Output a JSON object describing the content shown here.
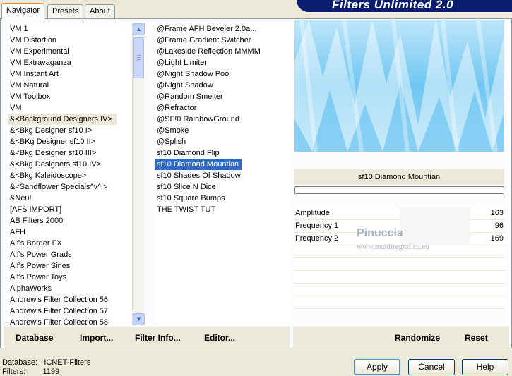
{
  "tabs": [
    {
      "label": "Navigator"
    },
    {
      "label": "Presets"
    },
    {
      "label": "About"
    }
  ],
  "banner": {
    "title": "Filters Unlimited 2.0"
  },
  "categories": [
    "VM 1",
    "VM Distortion",
    "VM Experimental",
    "VM Extravaganza",
    "VM Instant Art",
    "VM Natural",
    "VM Toolbox",
    "VM",
    "&<Background Designers IV>",
    "&<Bkg Designer sf10 I>",
    "&<BKg Designer sf10 II>",
    "&<Bkg Designer sf10 III>",
    "&<Bkg Designers sf10 IV>",
    "&<Bkg Kaleidoscope>",
    "&<Sandflower Specials^v^ >",
    "&Neu!",
    "[AFS IMPORT]",
    "AB Filters 2000",
    "AFH",
    "Alf's Border FX",
    "Alf's Power Grads",
    "Alf's Power Sines",
    "Alf's Power Toys",
    "AlphaWorks",
    "Andrew's Filter Collection 56",
    "Andrew's Filter Collection 57",
    "Andrew's Filter Collection 58"
  ],
  "filters": [
    "@Frame AFH Beveler 2.0a...",
    "@Frame Gradient Switcher",
    "@Lakeside Reflection MMMM",
    "@Light Limiter",
    "@Night Shadow Pool",
    "@Night Shadow",
    "@Random Smelter",
    "@Refractor",
    "@SF!0 RainbowGround",
    "@Smoke",
    "@Splish",
    "sf10 Diamond Flip",
    "sf10 Diamond Mountian",
    "sf10 Shades Of Shadow",
    "sf10 Slice N Dice",
    "sf10 Square Bumps",
    "THE TWIST TUT"
  ],
  "footer": {
    "database": "Database",
    "import": "Import...",
    "filter_info": "Filter Info...",
    "editor": "Editor...",
    "randomize": "Randomize",
    "reset": "Reset"
  },
  "selected_filter": "sf10 Diamond Mountian",
  "params": [
    {
      "label": "Amplitude",
      "value": "163"
    },
    {
      "label": "Frequency 1",
      "value": "96"
    },
    {
      "label": "Frequency 2",
      "value": "169"
    }
  ],
  "watermark": {
    "name": "Pinuccia",
    "url": "www.maidiregrafica.eu"
  },
  "status": {
    "db_label": "Database:",
    "db_value": "ICNET-Filters",
    "filters_label": "Filters:",
    "filters_value": "1199"
  },
  "buttons": {
    "apply": "Apply",
    "cancel": "Cancel",
    "help": "Help"
  }
}
